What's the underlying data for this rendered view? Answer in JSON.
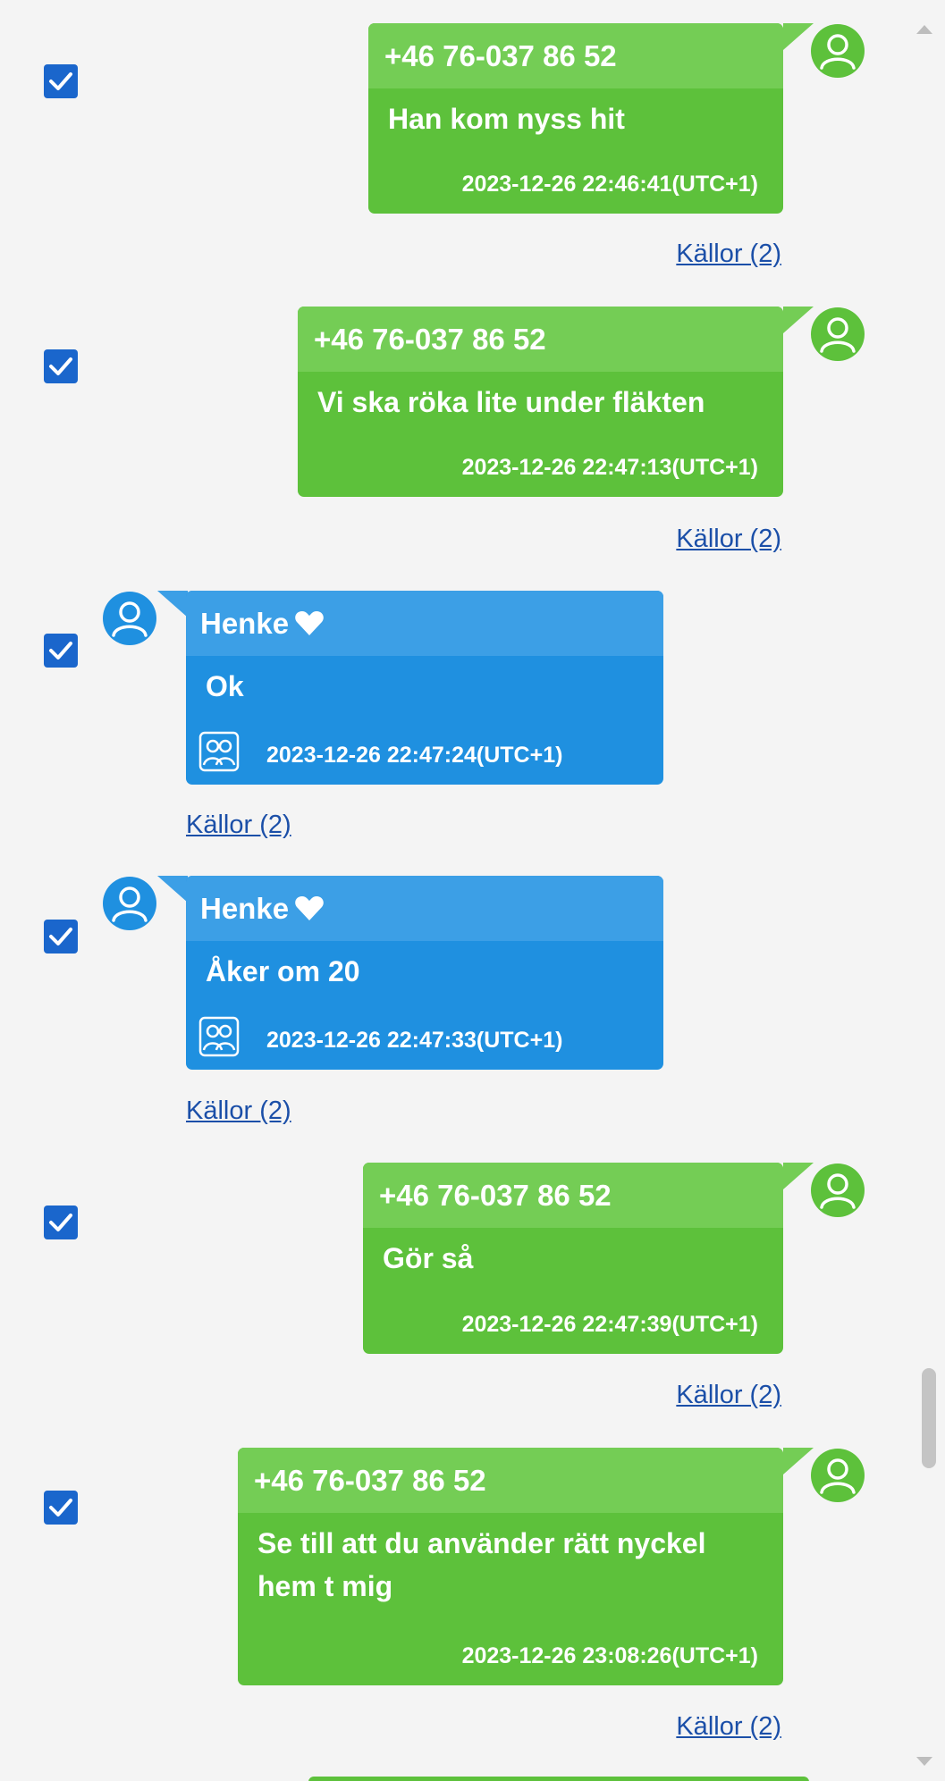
{
  "colors": {
    "outgoing_bubble": "#5dc13b",
    "outgoing_header": "#74cd55",
    "incoming_bubble": "#1f90e0",
    "incoming_header": "#3c9fe6",
    "checkbox": "#1a66cc",
    "link": "#1b4fa8",
    "background": "#f4f4f4"
  },
  "messages": [
    {
      "direction": "outgoing",
      "selected": true,
      "sender": "+46 76-037 86 52",
      "text": "Han kom nyss hit",
      "timestamp": "2023-12-26 22:46:41(UTC+1)",
      "sources": "Källor (2)"
    },
    {
      "direction": "outgoing",
      "selected": true,
      "sender": "+46 76-037 86 52",
      "text": "Vi ska röka lite under fläkten",
      "timestamp": "2023-12-26 22:47:13(UTC+1)",
      "sources": "Källor (2)"
    },
    {
      "direction": "incoming",
      "selected": true,
      "sender": "Henke",
      "sender_icon": "heart-icon",
      "text": "Ok",
      "timestamp": "2023-12-26 22:47:24(UTC+1)",
      "sources": "Källor (2)"
    },
    {
      "direction": "incoming",
      "selected": true,
      "sender": "Henke",
      "sender_icon": "heart-icon",
      "text": "Åker om 20",
      "timestamp": "2023-12-26 22:47:33(UTC+1)",
      "sources": "Källor (2)"
    },
    {
      "direction": "outgoing",
      "selected": true,
      "sender": "+46 76-037 86 52",
      "text": "Gör så",
      "timestamp": "2023-12-26 22:47:39(UTC+1)",
      "sources": "Källor (2)"
    },
    {
      "direction": "outgoing",
      "selected": true,
      "sender": "+46 76-037 86 52",
      "text": "Se till att du använder rätt nyckel hem t mig",
      "timestamp": "2023-12-26 23:08:26(UTC+1)",
      "sources": "Källor (2)"
    }
  ]
}
